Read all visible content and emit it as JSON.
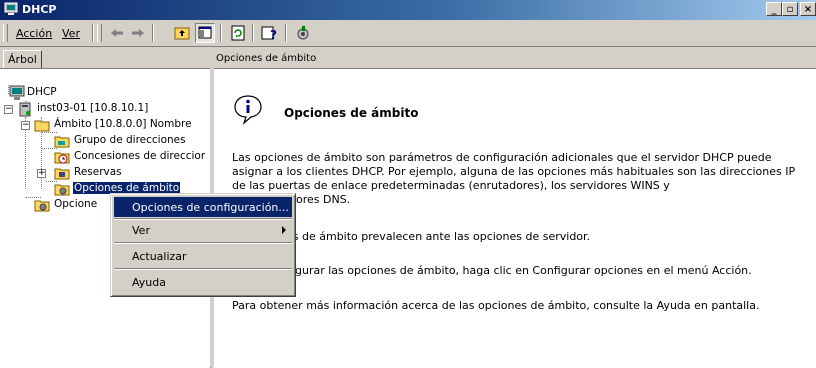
{
  "window": {
    "title": "DHCP",
    "controls": [
      "minimize-icon",
      "restore-icon",
      "close-icon"
    ]
  },
  "menu": {
    "accion": "Acción",
    "ver": "Ver"
  },
  "toolbar": {
    "buttons": [
      "back-arrow-icon",
      "forward-arrow-icon",
      "up-folder-icon",
      "show-hide-tree-icon",
      "refresh-icon",
      "export-icon",
      "help-icon",
      "server-icon"
    ]
  },
  "tree_panel": {
    "tab_label": "Árbol"
  },
  "tree": {
    "root": "DHCP",
    "server": "inst03-01 [10.8.10.1]",
    "scope": "Ámbito [10.8.0.0] Nombre",
    "pool": "Grupo de direcciones",
    "leases": "Concesiones de direccior",
    "reservations": "Reservas",
    "scope_options": "Opciones de ámbito",
    "server_options": "Opcione"
  },
  "result": {
    "header": "Opciones de ámbito",
    "heading": "Opciones de ámbito",
    "p1": "Las opciones de ámbito son parámetros de configuración adicionales que el servidor DHCP puede asignar a los clientes DHCP. Por ejemplo, alguna de las opciones más habituales son las direcciones IP de las puertas de enlace predeterminadas (enrutadores), los servidores WINS y",
    "p1_tail": "ores DNS.",
    "p2": "es de ámbito prevalecen ante las opciones de servidor.",
    "p3": "gurar las opciones de ámbito, haga clic en Configurar opciones en el menú Acción.",
    "p4": "Para obtener más información acerca de las opciones de ámbito, consulte la Ayuda en pantalla."
  },
  "context_menu": {
    "configure": "Opciones de configuración...",
    "view": "Ver",
    "refresh": "Actualizar",
    "help": "Ayuda"
  },
  "colors": {
    "selection": "#0a246a",
    "face": "#d4d0c8"
  }
}
